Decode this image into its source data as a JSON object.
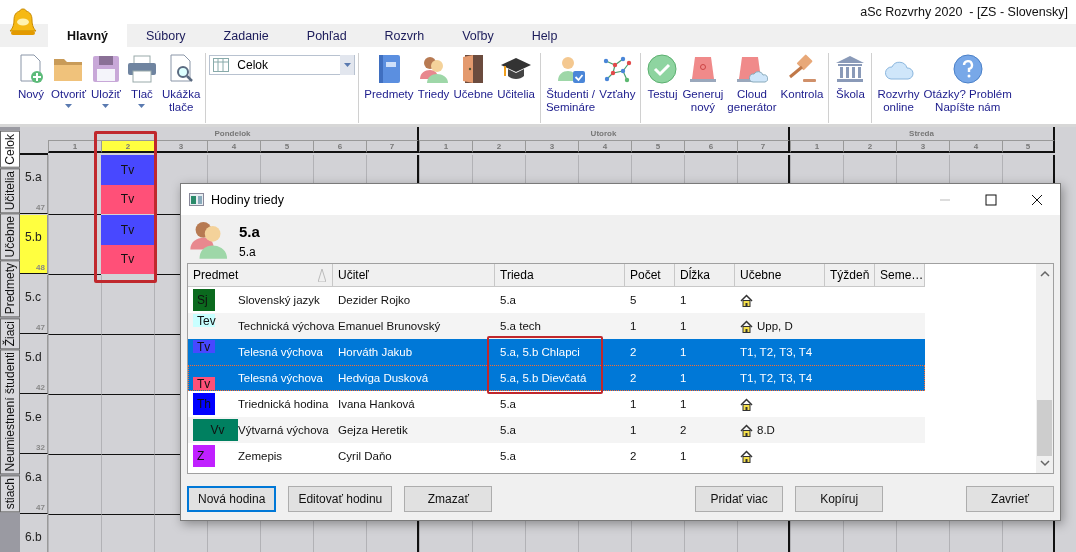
{
  "window": {
    "title": "aSc Rozvrhy 2020  - [ZS - Slovensky]"
  },
  "menu_tabs": [
    {
      "label": "Hlavný",
      "selected": true
    },
    {
      "label": "Súbory",
      "selected": false
    },
    {
      "label": "Zadanie",
      "selected": false
    },
    {
      "label": "Pohľad",
      "selected": false
    },
    {
      "label": "Rozvrh",
      "selected": false
    },
    {
      "label": "Voľby",
      "selected": false
    },
    {
      "label": "Help",
      "selected": false
    }
  ],
  "ribbon": {
    "groups": [
      {
        "items": [
          {
            "kind": "button",
            "label": "Nový",
            "menu": false
          },
          {
            "kind": "button",
            "label": "Otvoriť",
            "menu": true
          },
          {
            "kind": "button",
            "label": "Uložiť",
            "menu": true
          },
          {
            "kind": "button",
            "label": "Tlač",
            "menu": true
          },
          {
            "kind": "button",
            "label": "Ukážka\ntlače",
            "menu": false
          }
        ]
      },
      {
        "items": [
          {
            "kind": "dropdown",
            "value": "Celok"
          }
        ]
      },
      {
        "items": [
          {
            "kind": "button",
            "label": "Predmety",
            "menu": false
          },
          {
            "kind": "button",
            "label": "Triedy",
            "menu": false
          },
          {
            "kind": "button",
            "label": "Učebne",
            "menu": false
          },
          {
            "kind": "button",
            "label": "Učitelia",
            "menu": false
          }
        ]
      },
      {
        "items": [
          {
            "kind": "button",
            "label": "Študenti /\nSemináre",
            "menu": false
          },
          {
            "kind": "button",
            "label": "Vzťahy",
            "menu": false
          }
        ]
      },
      {
        "items": [
          {
            "kind": "button",
            "label": "Testuj",
            "menu": false
          },
          {
            "kind": "button",
            "label": "Generuj\nnový",
            "menu": false
          },
          {
            "kind": "button",
            "label": "Cloud\ngenerátor",
            "menu": false
          },
          {
            "kind": "button",
            "label": "Kontrola",
            "menu": false
          }
        ]
      },
      {
        "items": [
          {
            "kind": "button",
            "label": "Škola",
            "menu": false
          }
        ]
      },
      {
        "items": [
          {
            "kind": "button",
            "label": "Rozvrhy\nonline",
            "menu": false
          },
          {
            "kind": "button",
            "label": "Otázky? Problém\nNapíšte nám",
            "menu": false
          }
        ]
      }
    ]
  },
  "side_tabs": [
    {
      "label": "Celok",
      "selected": true
    },
    {
      "label": "Učitelia",
      "selected": false
    },
    {
      "label": "Učebne",
      "selected": false
    },
    {
      "label": "Predmety",
      "selected": false
    },
    {
      "label": "Žiaci",
      "selected": false
    },
    {
      "label": "Neumiestnení študenti",
      "selected": false
    },
    {
      "label": "stiach",
      "selected": false
    }
  ],
  "timetable": {
    "days": [
      {
        "name": "Pondelok",
        "periods": [
          {
            "label": "1",
            "selected": false,
            "marked": false
          },
          {
            "label": "2",
            "selected": true,
            "marked": true
          },
          {
            "label": "3",
            "selected": false,
            "marked": false
          },
          {
            "label": "4",
            "selected": false,
            "marked": false
          },
          {
            "label": "5",
            "selected": false,
            "marked": false
          },
          {
            "label": "6",
            "selected": false,
            "marked": false
          },
          {
            "label": "7",
            "selected": false,
            "marked": false
          }
        ]
      },
      {
        "name": "Utorok",
        "periods": [
          {
            "label": "1",
            "selected": false,
            "marked": false
          },
          {
            "label": "2",
            "selected": false,
            "marked": false
          },
          {
            "label": "3",
            "selected": false,
            "marked": false
          },
          {
            "label": "4",
            "selected": false,
            "marked": false
          },
          {
            "label": "5",
            "selected": false,
            "marked": false
          },
          {
            "label": "6",
            "selected": false,
            "marked": false
          },
          {
            "label": "7",
            "selected": false,
            "marked": false
          }
        ]
      },
      {
        "name": "Streda",
        "periods": [
          {
            "label": "1",
            "selected": false,
            "marked": false
          },
          {
            "label": "2",
            "selected": false,
            "marked": false
          },
          {
            "label": "3",
            "selected": false,
            "marked": false
          },
          {
            "label": "4",
            "selected": false,
            "marked": false
          },
          {
            "label": "5",
            "selected": false,
            "marked": false
          }
        ]
      }
    ],
    "classes": [
      {
        "name": "5.a",
        "count": "47",
        "selected": false,
        "lessons": [
          {
            "subject": "Tv",
            "color": "#4848ff"
          },
          {
            "subject": "Tv",
            "color": "#ff5078"
          }
        ]
      },
      {
        "name": "5.b",
        "count": "48",
        "selected": true,
        "lessons": [
          {
            "subject": "Tv",
            "color": "#4848ff"
          },
          {
            "subject": "Tv",
            "color": "#ff5078"
          }
        ]
      },
      {
        "name": "5.c",
        "count": "47",
        "selected": false
      },
      {
        "name": "5.d",
        "count": "42",
        "selected": false
      },
      {
        "name": "5.e",
        "count": "32",
        "selected": false
      },
      {
        "name": "6.a",
        "count": "47",
        "selected": false
      },
      {
        "name": "6.b",
        "selected": false
      }
    ]
  },
  "dialog": {
    "title": "Hodiny triedy",
    "heading": "5.a",
    "subheading": "5.a",
    "columns": [
      "Predmet",
      "Učiteľ",
      "Trieda",
      "Počet",
      "Dĺžka",
      "Učebne",
      "Týždeň",
      "Seme…"
    ],
    "rows": [
      {
        "tile": {
          "code": "Sj",
          "color": "#0b6a1e",
          "kind": "full"
        },
        "subject": "Slovenský jazyk",
        "teacher": "Dezider Rojko",
        "class": "5.a",
        "count": "5",
        "length": "1",
        "room_icon": true,
        "rooms": "",
        "selected": false,
        "focused": false,
        "marked": false
      },
      {
        "tile": {
          "code": "Tev",
          "color": "#c8ffff",
          "kind": "top"
        },
        "subject": "Technická výchova",
        "teacher": "Emanuel Brunovský",
        "class": "5.a tech",
        "count": "1",
        "length": "1",
        "room_icon": true,
        "rooms": "Upp, D",
        "selected": false,
        "focused": false,
        "marked": false
      },
      {
        "tile": {
          "code": "Tv",
          "color": "#4848ff",
          "kind": "top"
        },
        "subject": "Telesná výchova",
        "teacher": "Horváth Jakub",
        "class": "5.a, 5.b Chlapci",
        "count": "2",
        "length": "1",
        "room_icon": false,
        "rooms": "T1, T2, T3, T4",
        "selected": true,
        "focused": false,
        "marked": true
      },
      {
        "tile": {
          "code": "Tv",
          "color": "#ff5078",
          "kind": "bottom"
        },
        "subject": "Telesná výchova",
        "teacher": "Hedviga Dusková",
        "class": "5.a, 5.b Dievčatá",
        "count": "2",
        "length": "1",
        "room_icon": false,
        "rooms": "T1, T2, T3, T4",
        "selected": true,
        "focused": true,
        "marked": true
      },
      {
        "tile": {
          "code": "Th",
          "color": "#0000ff",
          "kind": "full"
        },
        "subject": "Triednická hodina",
        "teacher": "Ivana Hanková",
        "class": "5.a",
        "count": "1",
        "length": "1",
        "room_icon": true,
        "rooms": "",
        "selected": false,
        "focused": false,
        "marked": false
      },
      {
        "tile": {
          "code": "Vv",
          "color": "#008060",
          "kind": "wide"
        },
        "subject": "Výtvarná výchova",
        "teacher": "Gejza Heretik",
        "class": "5.a",
        "count": "1",
        "length": "2",
        "room_icon": true,
        "rooms": "8.D",
        "selected": false,
        "focused": false,
        "marked": false
      },
      {
        "tile": {
          "code": "Z",
          "color": "#c020ff",
          "kind": "full"
        },
        "subject": "Zemepis",
        "teacher": "Cyril Daňo",
        "class": "5.a",
        "count": "2",
        "length": "1",
        "room_icon": true,
        "rooms": "",
        "selected": false,
        "focused": false,
        "marked": false
      }
    ],
    "button_groups": [
      [
        {
          "label": "Nová hodina",
          "default": true
        },
        {
          "label": "Editovať hodinu",
          "default": false
        },
        {
          "label": "Zmazať",
          "default": false
        }
      ],
      [
        {
          "label": "Pridať viac",
          "default": false
        },
        {
          "label": "Kopíruj",
          "default": false
        }
      ],
      [
        {
          "label": "Zavrieť",
          "default": false
        }
      ]
    ]
  }
}
